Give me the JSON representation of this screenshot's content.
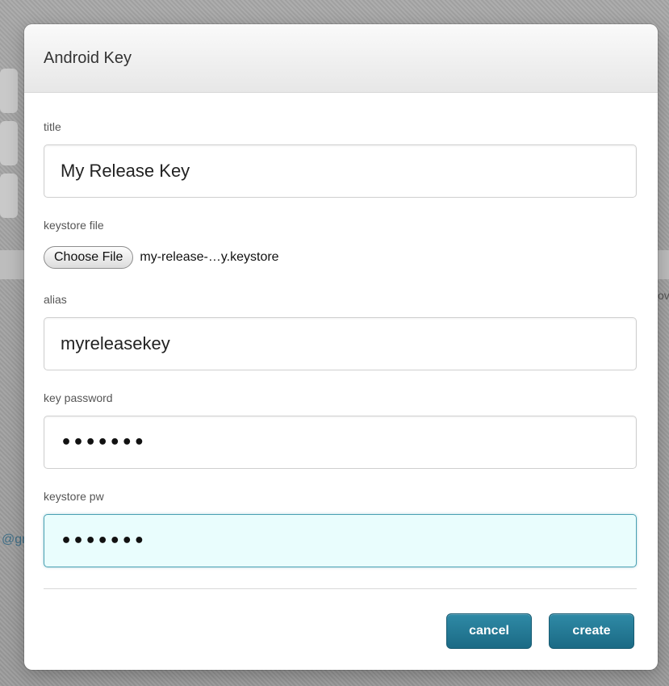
{
  "modal": {
    "title": "Android Key"
  },
  "form": {
    "title_label": "title",
    "title_value": "My Release Key",
    "keystore_label": "keystore file",
    "choose_file_label": "Choose File",
    "file_name": "my-release-…y.keystore",
    "alias_label": "alias",
    "alias_value": "myreleasekey",
    "key_password_label": "key password",
    "key_password_value": "•••••••",
    "keystore_pw_label": "keystore pw",
    "keystore_pw_value": "•••••••"
  },
  "actions": {
    "cancel_label": "cancel",
    "create_label": "create"
  },
  "background": {
    "fragment_left": "@gr",
    "fragment_right": "ov"
  },
  "colors": {
    "accent": "#1f7893",
    "focus_bg": "#e9fdfd"
  }
}
